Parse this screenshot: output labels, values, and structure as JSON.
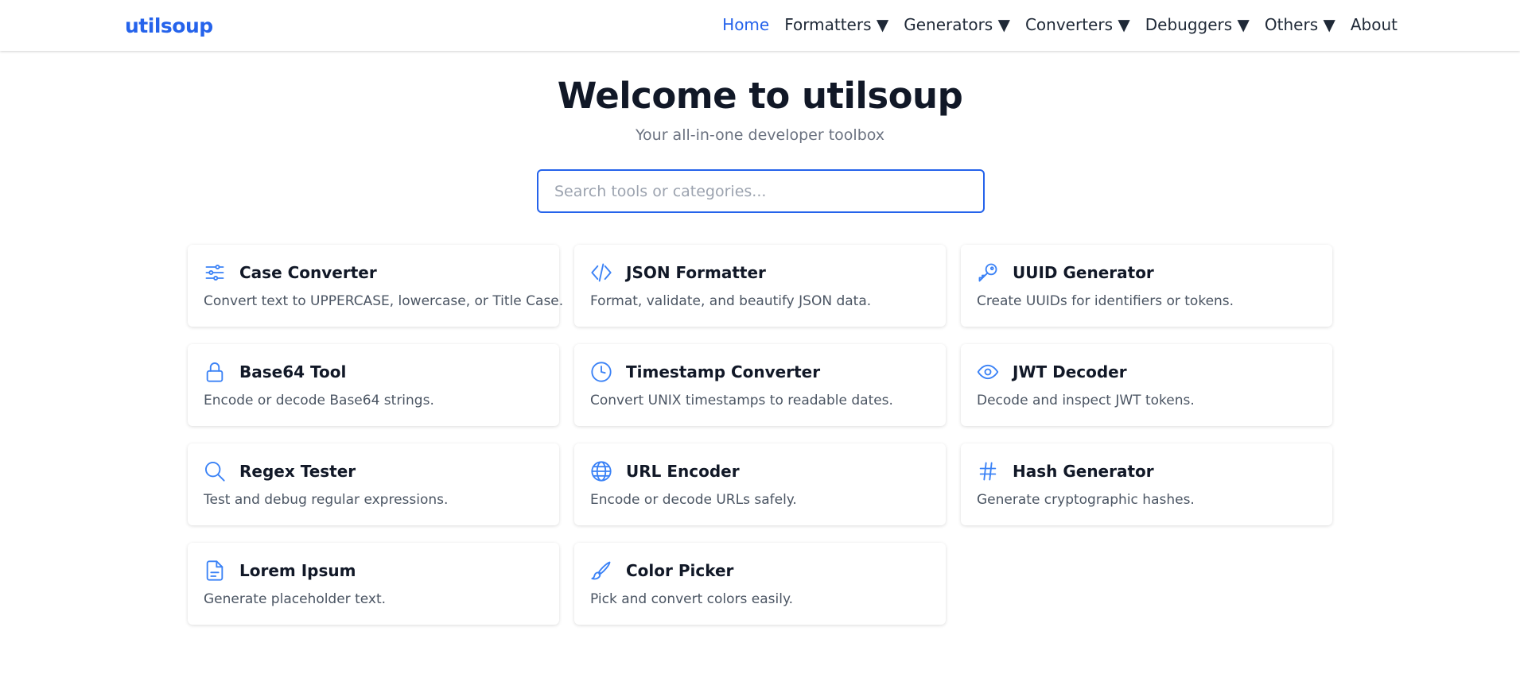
{
  "brand": {
    "logo": "utilsoup",
    "accent": "#2563eb"
  },
  "nav": {
    "items": [
      {
        "label": "Home"
      },
      {
        "label": "Formatters ▼"
      },
      {
        "label": "Generators ▼"
      },
      {
        "label": "Converters ▼"
      },
      {
        "label": "Debuggers ▼"
      },
      {
        "label": "Others ▼"
      },
      {
        "label": "About"
      }
    ]
  },
  "hero": {
    "title": "Welcome to utilsoup",
    "subtitle": "Your all-in-one developer toolbox"
  },
  "search": {
    "placeholder": "Search tools or categories...",
    "value": ""
  },
  "tools": [
    {
      "title": "Case Converter",
      "description": "Convert text to UPPERCASE, lowercase, or Title Case.",
      "icon": "sliders-icon"
    },
    {
      "title": "JSON Formatter",
      "description": "Format, validate, and beautify JSON data.",
      "icon": "code-icon"
    },
    {
      "title": "UUID Generator",
      "description": "Create UUIDs for identifiers or tokens.",
      "icon": "key-icon"
    },
    {
      "title": "Base64 Tool",
      "description": "Encode or decode Base64 strings.",
      "icon": "lock-icon"
    },
    {
      "title": "Timestamp Converter",
      "description": "Convert UNIX timestamps to readable dates.",
      "icon": "clock-icon"
    },
    {
      "title": "JWT Decoder",
      "description": "Decode and inspect JWT tokens.",
      "icon": "eye-icon"
    },
    {
      "title": "Regex Tester",
      "description": "Test and debug regular expressions.",
      "icon": "search-icon"
    },
    {
      "title": "URL Encoder",
      "description": "Encode or decode URLs safely.",
      "icon": "globe-icon"
    },
    {
      "title": "Hash Generator",
      "description": "Generate cryptographic hashes.",
      "icon": "hash-icon"
    },
    {
      "title": "Lorem Ipsum",
      "description": "Generate placeholder text.",
      "icon": "document-icon"
    },
    {
      "title": "Color Picker",
      "description": "Pick and convert colors easily.",
      "icon": "paintbrush-icon"
    }
  ]
}
